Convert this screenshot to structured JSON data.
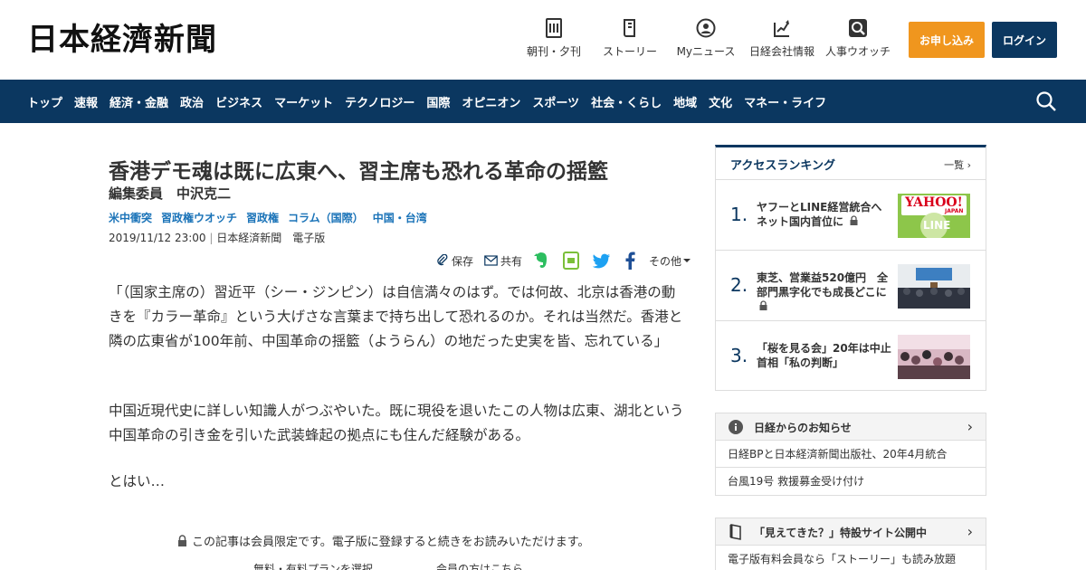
{
  "header": {
    "logo": "日本経濟新聞",
    "links": [
      {
        "label": "朝刊・夕刊",
        "icon": "newspaper-icon"
      },
      {
        "label": "ストーリー",
        "icon": "book-icon"
      },
      {
        "label": "Myニュース",
        "icon": "user-icon"
      },
      {
        "label": "日経会社情報",
        "icon": "chart-icon"
      },
      {
        "label": "人事ウオッチ",
        "icon": "search-person-icon"
      }
    ],
    "apply_label": "お申し込み",
    "login_label": "ログイン",
    "apply_color": "#f0961e",
    "brand_color": "#0b3760"
  },
  "nav": {
    "items": [
      "トップ",
      "速報",
      "経済・金融",
      "政治",
      "ビジネス",
      "マーケット",
      "テクノロジー",
      "国際",
      "オピニオン",
      "スポーツ",
      "社会・くらし",
      "地域",
      "文化",
      "マネー・ライフ"
    ]
  },
  "article": {
    "title": "香港デモ魂は既に広東へ、習主席も恐れる革命の揺籃",
    "author": "編集委員　中沢克二",
    "tags": [
      "米中衝突",
      "習政権ウオッチ",
      "習政権",
      "コラム（国際）",
      "中国・台湾"
    ],
    "date": "2019/11/12 23:00",
    "source": "日本経済新聞　電子版",
    "actions": {
      "save": "保存",
      "share": "共有",
      "more": "その他"
    },
    "paragraphs": [
      "「（国家主席の）習近平（シー・ジンピン）は自信満々のはず。では何故、北京は香港の動きを『カラー革命』という大げさな言葉まで持ち出して恐れるのか。それは当然だ。香港と隣の広東省が100年前、中国革命の揺籃（ようらん）の地だった史実を皆、忘れている」",
      "中国近現代史に詳しい知識人がつぶやいた。既に現役を退いたこの人物は広東、湖北という中国革命の引き金を引いた武装蜂起の拠点にも住んだ経験がある。",
      "とはい…"
    ],
    "locked_note": "この記事は会員限定です。電子版に登録すると続きをお読みいただけます。",
    "plan_link": "無料・有料プランを選択",
    "member_link": "会員の方はこちら"
  },
  "ranking": {
    "title": "アクセスランキング",
    "more": "一覧",
    "items": [
      {
        "num": "1.",
        "text": "ヤフーとLINE経営統合へ　ネット国内首位に",
        "locked": true
      },
      {
        "num": "2.",
        "text": "東芝、営業益520億円　全部門黒字化でも成長どこに",
        "locked": true
      },
      {
        "num": "3.",
        "text": "「桜を見る会」20年は中止　首相「私の判断」",
        "locked": false
      }
    ],
    "thumb1_text_top": "YAHOO!",
    "thumb1_text_sub": "JAPAN",
    "thumb1_text_bottom": "LINE"
  },
  "notices": {
    "title": "日経からのお知らせ",
    "items": [
      "日経BPと日本経済新聞出版社、20年4月統合",
      "台風19号 救援募金受け付け"
    ]
  },
  "story": {
    "title": "「見えてきた？」特設サイト公開中",
    "text": "電子版有料会員なら「ストーリー」も読み放題"
  }
}
